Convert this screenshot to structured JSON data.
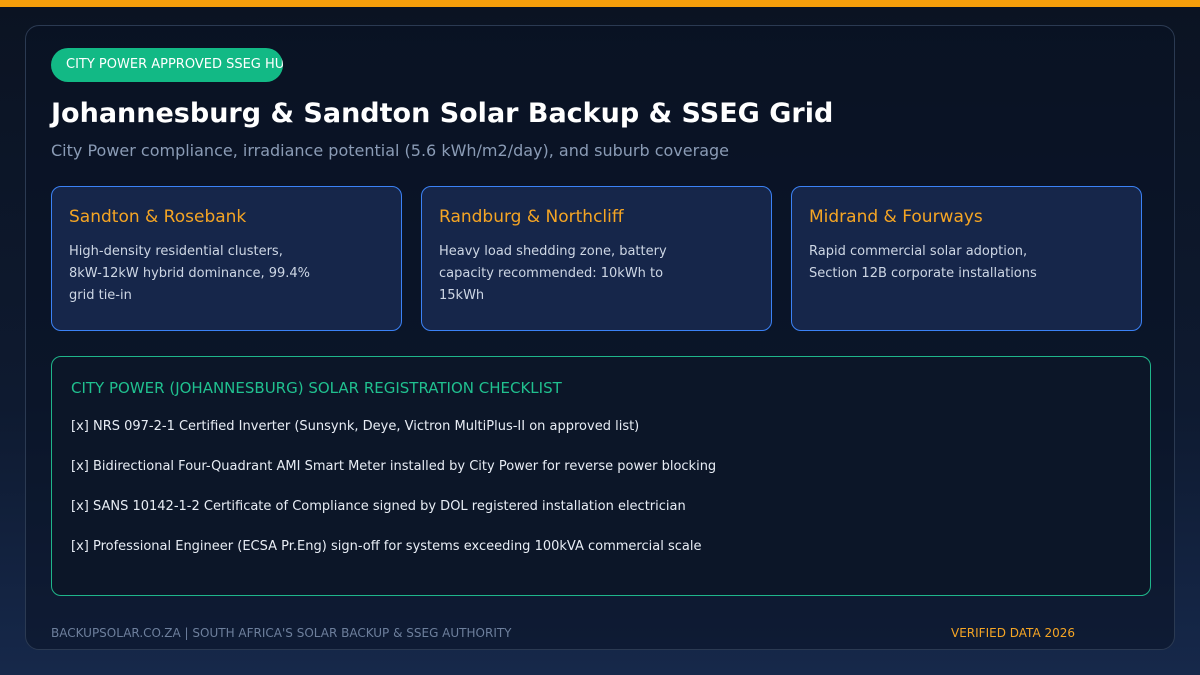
{
  "accent": "#f59e0b",
  "badge": "CITY POWER APPROVED SSEG HUB",
  "title": "Johannesburg & Sandton Solar Backup & SSEG Grid",
  "subtitle": "City Power compliance, irradiance potential (5.6 kWh/m2/day), and suburb coverage",
  "suburbs": [
    {
      "name": "Sandton & Rosebank",
      "description": "High-density residential clusters, 8kW-12kW hybrid dominance, 99.4% grid tie-in"
    },
    {
      "name": "Randburg & Northcliff",
      "description": "Heavy load shedding zone, battery capacity recommended: 10kWh to 15kWh"
    },
    {
      "name": "Midrand & Fourways",
      "description": "Rapid commercial solar adoption, Section 12B corporate installations"
    }
  ],
  "checklist": {
    "title": "CITY POWER (JOHANNESBURG) SOLAR REGISTRATION CHECKLIST",
    "items": [
      "[x] NRS 097-2-1 Certified Inverter (Sunsynk, Deye, Victron MultiPlus-II on approved list)",
      "[x] Bidirectional Four-Quadrant AMI Smart Meter installed by City Power for reverse power blocking",
      "[x] SANS 10142-1-2 Certificate of Compliance signed by DOL registered installation electrician",
      "[x] Professional Engineer (ECSA Pr.Eng) sign-off for systems exceeding 100kVA commercial scale"
    ]
  },
  "footer": {
    "left": "BACKUPSOLAR.CO.ZA | SOUTH AFRICA'S SOLAR BACKUP & SSEG AUTHORITY",
    "right": "VERIFIED DATA 2026"
  }
}
